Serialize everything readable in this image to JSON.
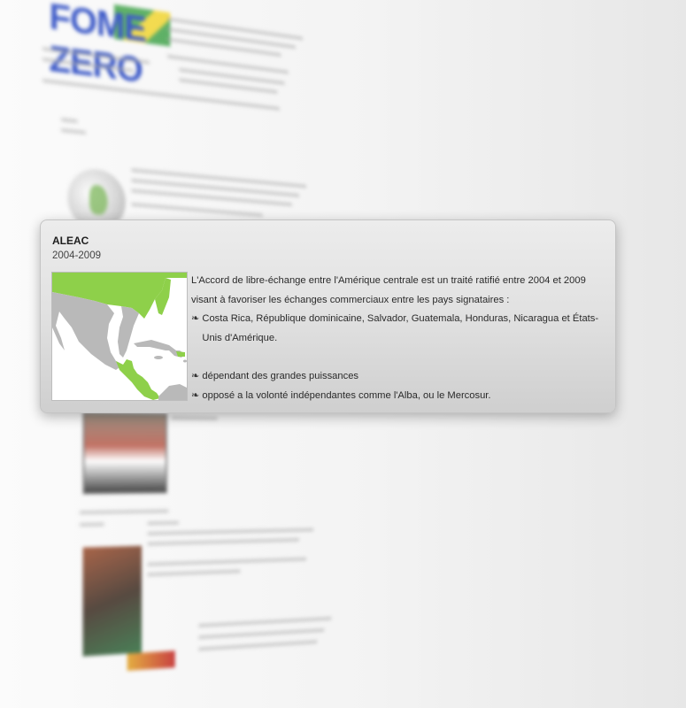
{
  "background": {
    "logo_text": "FOME ZERO"
  },
  "card": {
    "title": "ALEAC",
    "years": "2004-2009",
    "map_icon": "central-america-map",
    "intro": "L'Accord de libre-échange entre l'Amérique centrale est un traité ratifié entre 2004 et 2009 visant à favoriser les échanges commerciaux entre les pays signataires :",
    "bullet_mark": "❧",
    "bullets": [
      "Costa Rica, République dominicaine, Salvador, Guatemala, Honduras, Nicaragua et États-Unis d'Amérique.",
      "dépendant des grandes puissances",
      "opposé a la volonté indépendantes comme l'Alba, ou le Mercosur."
    ]
  },
  "colors": {
    "map_highlight": "#8ed04a",
    "map_land": "#b9b9b9",
    "logo_blue": "#1d3fbf"
  }
}
